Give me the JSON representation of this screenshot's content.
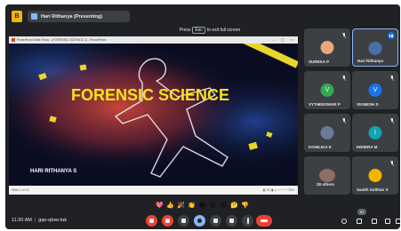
{
  "header": {
    "badge_label": "B",
    "presenting_label": "Hari Rithanya (Presenting)"
  },
  "toast": {
    "before": "Press",
    "key": "Esc",
    "after": "to exit full screen"
  },
  "presentation": {
    "window_title": "PowerPoint Slide Show - [FORENSIC SCIENCE 1] - PowerPoint",
    "window_controls": "– ▢ ×",
    "slide_title": "FORENSIC SCIENCE",
    "slide_author": "HARI RITHANYA S",
    "status_left": "Slide 1 of 13",
    "status_right": "◧ ⊞ ◨ ▭ ─── + 76%"
  },
  "participants": [
    {
      "name": "SUREKA P",
      "initial": "",
      "color": "#e8a87c",
      "active": false
    },
    {
      "name": "Hari Rithanya",
      "initial": "",
      "color": "#4a6fa5",
      "active": true
    },
    {
      "name": "VYTHEESWAR P",
      "initial": "V",
      "color": "#34a853",
      "active": false
    },
    {
      "name": "VIGNESH S",
      "initial": "V",
      "color": "#1a73e8",
      "active": false
    },
    {
      "name": "KOHILIKA E",
      "initial": "",
      "color": "#6b7a99",
      "active": false
    },
    {
      "name": "INDIERA M",
      "initial": "I",
      "color": "#12a4af",
      "active": false
    },
    {
      "name": "28 others",
      "initial": "",
      "color": "#8d6e63",
      "active": false
    },
    {
      "name": "Sasith Sulthan S",
      "initial": "",
      "color": "#f4b400",
      "active": false
    }
  ],
  "reactions": [
    "💖",
    "👍",
    "🎉",
    "👏",
    "😂",
    "😮",
    "😢",
    "🤔",
    "👎"
  ],
  "footer": {
    "time": "11:20 AM",
    "meeting_code": "gqe-qtow-tuk",
    "people_count": "51"
  },
  "colors": {
    "background": "#202124",
    "tile": "#3c4043",
    "danger": "#ea4335",
    "accent": "#8ab4f8",
    "slide_title": "#f5e31a"
  }
}
